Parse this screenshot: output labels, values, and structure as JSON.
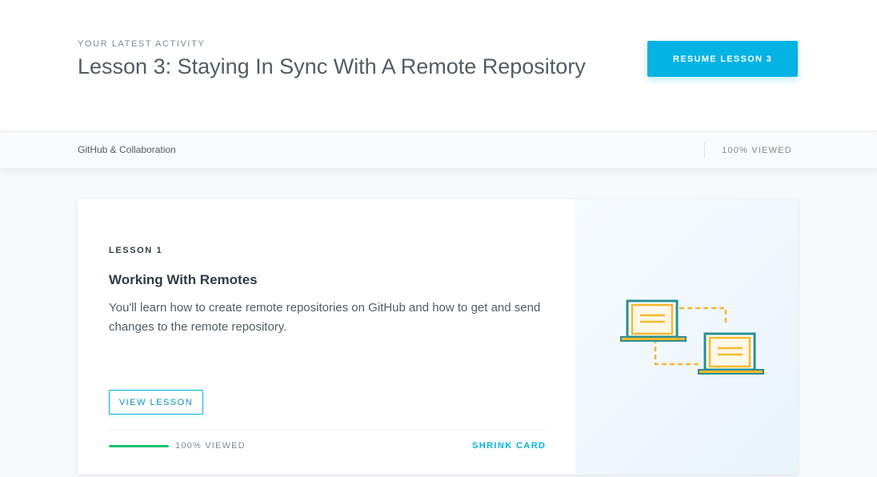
{
  "activity": {
    "eyebrow": "YOUR LATEST ACTIVITY",
    "title": "Lesson 3: Staying In Sync With A Remote Repository",
    "resume_label": "RESUME LESSON 3"
  },
  "course": {
    "name": "GitHub & Collaboration",
    "viewed": "100% VIEWED"
  },
  "lesson_card": {
    "number": "LESSON 1",
    "title": "Working With Remotes",
    "description": "You'll learn how to create remote repositories on GitHub and how to get and send changes to the remote repository.",
    "view_label": "VIEW LESSON",
    "progress_percent": 100,
    "viewed": "100% VIEWED",
    "shrink_label": "SHRINK CARD",
    "illustration_icon": "two-laptops-sync-icon"
  },
  "colors": {
    "accent": "#02b3e4",
    "progress": "#15c26b",
    "laptop_frame": "#2a8f8f",
    "laptop_accent": "#f5b82e"
  }
}
